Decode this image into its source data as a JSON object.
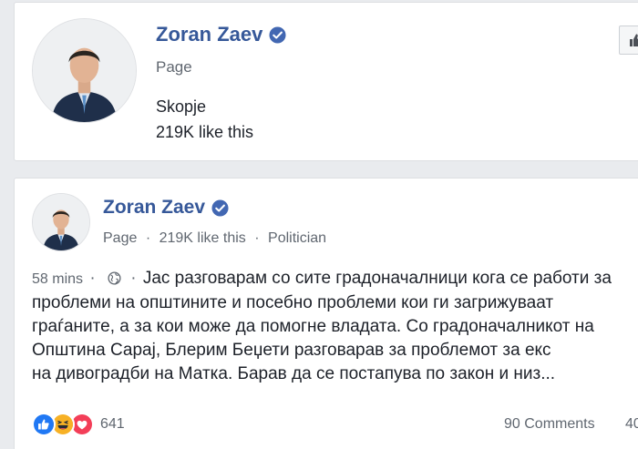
{
  "page_card": {
    "name": "Zoran Zaev",
    "type": "Page",
    "city": "Skopje",
    "likes": "219K like this"
  },
  "post": {
    "author": "Zoran Zaev",
    "meta": {
      "type": "Page",
      "likes": "219K like this",
      "category": "Politician"
    },
    "time": "58 mins",
    "separator": "·",
    "text_lines": [
      "Јас разговарам со сите градоначалници кога се работи за",
      "проблеми на општините и посебно проблеми кои ги загрижуваат",
      "граѓаните, а за кои може да помогне владата. Со градоначалникот на",
      "Општина Сарај, Блерим Беџети разговарав за проблемот за екс",
      "на дивоградби на Матка. Барав да се постапува по закон и низ..."
    ],
    "reaction_count": "641",
    "comments": "90 Comments",
    "shares": "40"
  },
  "colors": {
    "brand": "#365899",
    "verified": "#4267b2",
    "background": "#e9ebee",
    "like_reaction": "#2078f4",
    "love_reaction": "#f33e58",
    "haha_reaction": "#f7b125"
  },
  "icons": {
    "verified": "verified-badge-icon",
    "like_button": "thumbs-up-icon",
    "privacy": "globe-icon",
    "reactions": [
      "like-reaction-icon",
      "haha-reaction-icon",
      "love-reaction-icon"
    ]
  }
}
